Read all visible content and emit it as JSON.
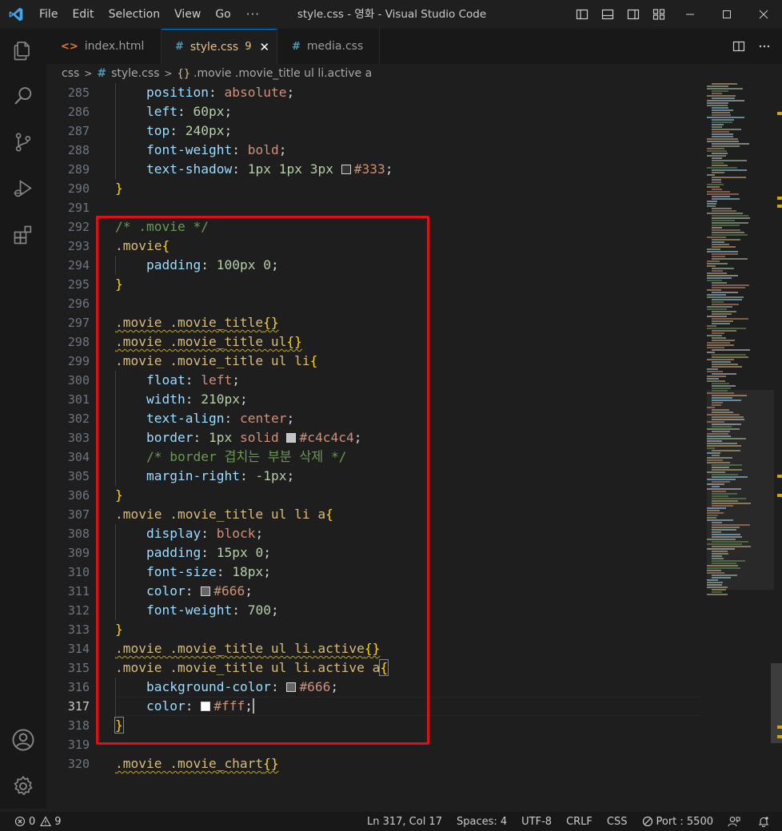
{
  "window": {
    "title": "style.css - 영화 - Visual Studio Code",
    "menu": [
      "File",
      "Edit",
      "Selection",
      "View",
      "Go"
    ],
    "menu_more": "···"
  },
  "tabs": [
    {
      "label": "index.html",
      "icon": "<>",
      "active": false
    },
    {
      "label": "style.css",
      "icon": "#",
      "active": true,
      "problems": "9"
    },
    {
      "label": "media.css",
      "icon": "#",
      "active": false
    }
  ],
  "breadcrumb": {
    "folder": "css",
    "file": "style.css",
    "symbol": ".movie .movie_title ul li.active a"
  },
  "editor": {
    "current_line": 317,
    "lines": [
      {
        "n": 285,
        "indent": 1,
        "tokens": [
          {
            "t": "position",
            "c": "prop"
          },
          {
            "t": ": ",
            "c": "punc"
          },
          {
            "t": "absolute",
            "c": "val"
          },
          {
            "t": ";",
            "c": "punc"
          }
        ]
      },
      {
        "n": 286,
        "indent": 1,
        "tokens": [
          {
            "t": "left",
            "c": "prop"
          },
          {
            "t": ": ",
            "c": "punc"
          },
          {
            "t": "60px",
            "c": "num"
          },
          {
            "t": ";",
            "c": "punc"
          }
        ]
      },
      {
        "n": 287,
        "indent": 1,
        "tokens": [
          {
            "t": "top",
            "c": "prop"
          },
          {
            "t": ": ",
            "c": "punc"
          },
          {
            "t": "240px",
            "c": "num"
          },
          {
            "t": ";",
            "c": "punc"
          }
        ]
      },
      {
        "n": 288,
        "indent": 1,
        "tokens": [
          {
            "t": "font-weight",
            "c": "prop"
          },
          {
            "t": ": ",
            "c": "punc"
          },
          {
            "t": "bold",
            "c": "val"
          },
          {
            "t": ";",
            "c": "punc"
          }
        ]
      },
      {
        "n": 289,
        "indent": 1,
        "tokens": [
          {
            "t": "text-shadow",
            "c": "prop"
          },
          {
            "t": ": ",
            "c": "punc"
          },
          {
            "t": "1px",
            "c": "num"
          },
          {
            "t": " ",
            "c": "punc"
          },
          {
            "t": "1px",
            "c": "num"
          },
          {
            "t": " ",
            "c": "punc"
          },
          {
            "t": "3px",
            "c": "num"
          },
          {
            "t": " ",
            "c": "punc"
          },
          {
            "swatch": "#333333"
          },
          {
            "t": "#333",
            "c": "val"
          },
          {
            "t": ";",
            "c": "punc"
          }
        ]
      },
      {
        "n": 290,
        "indent": 0,
        "tokens": [
          {
            "t": "}",
            "c": "brace"
          }
        ]
      },
      {
        "n": 291,
        "indent": 0,
        "tokens": []
      },
      {
        "n": 292,
        "indent": 0,
        "tokens": [
          {
            "t": "/* .movie */",
            "c": "cmt"
          }
        ]
      },
      {
        "n": 293,
        "indent": 0,
        "tokens": [
          {
            "t": ".movie",
            "c": "sel"
          },
          {
            "t": "{",
            "c": "brace"
          }
        ]
      },
      {
        "n": 294,
        "indent": 1,
        "tokens": [
          {
            "t": "padding",
            "c": "prop"
          },
          {
            "t": ": ",
            "c": "punc"
          },
          {
            "t": "100px",
            "c": "num"
          },
          {
            "t": " ",
            "c": "punc"
          },
          {
            "t": "0",
            "c": "num"
          },
          {
            "t": ";",
            "c": "punc"
          }
        ]
      },
      {
        "n": 295,
        "indent": 0,
        "tokens": [
          {
            "t": "}",
            "c": "brace"
          }
        ]
      },
      {
        "n": 296,
        "indent": 0,
        "tokens": []
      },
      {
        "n": 297,
        "indent": 0,
        "tokens": [
          {
            "t": ".movie .movie_title",
            "c": "sel",
            "sq": true
          },
          {
            "t": "{}",
            "c": "brace",
            "sq": true
          }
        ]
      },
      {
        "n": 298,
        "indent": 0,
        "tokens": [
          {
            "t": ".movie .movie_title ul",
            "c": "sel",
            "sq": true
          },
          {
            "t": "{}",
            "c": "brace",
            "sq": true
          }
        ]
      },
      {
        "n": 299,
        "indent": 0,
        "tokens": [
          {
            "t": ".movie .movie_title ul li",
            "c": "sel"
          },
          {
            "t": "{",
            "c": "brace"
          }
        ]
      },
      {
        "n": 300,
        "indent": 1,
        "tokens": [
          {
            "t": "float",
            "c": "prop"
          },
          {
            "t": ": ",
            "c": "punc"
          },
          {
            "t": "left",
            "c": "val"
          },
          {
            "t": ";",
            "c": "punc"
          }
        ]
      },
      {
        "n": 301,
        "indent": 1,
        "tokens": [
          {
            "t": "width",
            "c": "prop"
          },
          {
            "t": ": ",
            "c": "punc"
          },
          {
            "t": "210px",
            "c": "num"
          },
          {
            "t": ";",
            "c": "punc"
          }
        ]
      },
      {
        "n": 302,
        "indent": 1,
        "tokens": [
          {
            "t": "text-align",
            "c": "prop"
          },
          {
            "t": ": ",
            "c": "punc"
          },
          {
            "t": "center",
            "c": "val"
          },
          {
            "t": ";",
            "c": "punc"
          }
        ]
      },
      {
        "n": 303,
        "indent": 1,
        "tokens": [
          {
            "t": "border",
            "c": "prop"
          },
          {
            "t": ": ",
            "c": "punc"
          },
          {
            "t": "1px",
            "c": "num"
          },
          {
            "t": " ",
            "c": "punc"
          },
          {
            "t": "solid",
            "c": "val"
          },
          {
            "t": " ",
            "c": "punc"
          },
          {
            "swatch": "#c4c4c4"
          },
          {
            "t": "#c4c4c4",
            "c": "val"
          },
          {
            "t": ";",
            "c": "punc"
          }
        ]
      },
      {
        "n": 304,
        "indent": 1,
        "tokens": [
          {
            "t": "/* border 겹치는 부분 삭제 */",
            "c": "cmt"
          }
        ]
      },
      {
        "n": 305,
        "indent": 1,
        "tokens": [
          {
            "t": "margin-right",
            "c": "prop"
          },
          {
            "t": ": ",
            "c": "punc"
          },
          {
            "t": "-1px",
            "c": "num"
          },
          {
            "t": ";",
            "c": "punc"
          }
        ]
      },
      {
        "n": 306,
        "indent": 0,
        "tokens": [
          {
            "t": "}",
            "c": "brace"
          }
        ]
      },
      {
        "n": 307,
        "indent": 0,
        "tokens": [
          {
            "t": ".movie .movie_title ul li a",
            "c": "sel"
          },
          {
            "t": "{",
            "c": "brace"
          }
        ]
      },
      {
        "n": 308,
        "indent": 1,
        "tokens": [
          {
            "t": "display",
            "c": "prop"
          },
          {
            "t": ": ",
            "c": "punc"
          },
          {
            "t": "block",
            "c": "val"
          },
          {
            "t": ";",
            "c": "punc"
          }
        ]
      },
      {
        "n": 309,
        "indent": 1,
        "tokens": [
          {
            "t": "padding",
            "c": "prop"
          },
          {
            "t": ": ",
            "c": "punc"
          },
          {
            "t": "15px",
            "c": "num"
          },
          {
            "t": " ",
            "c": "punc"
          },
          {
            "t": "0",
            "c": "num"
          },
          {
            "t": ";",
            "c": "punc"
          }
        ]
      },
      {
        "n": 310,
        "indent": 1,
        "tokens": [
          {
            "t": "font-size",
            "c": "prop"
          },
          {
            "t": ": ",
            "c": "punc"
          },
          {
            "t": "18px",
            "c": "num"
          },
          {
            "t": ";",
            "c": "punc"
          }
        ]
      },
      {
        "n": 311,
        "indent": 1,
        "tokens": [
          {
            "t": "color",
            "c": "prop"
          },
          {
            "t": ": ",
            "c": "punc"
          },
          {
            "swatch": "#666666"
          },
          {
            "t": "#666",
            "c": "val"
          },
          {
            "t": ";",
            "c": "punc"
          }
        ]
      },
      {
        "n": 312,
        "indent": 1,
        "tokens": [
          {
            "t": "font-weight",
            "c": "prop"
          },
          {
            "t": ": ",
            "c": "punc"
          },
          {
            "t": "700",
            "c": "num"
          },
          {
            "t": ";",
            "c": "punc"
          }
        ]
      },
      {
        "n": 313,
        "indent": 0,
        "tokens": [
          {
            "t": "}",
            "c": "brace"
          }
        ]
      },
      {
        "n": 314,
        "indent": 0,
        "tokens": [
          {
            "t": ".movie .movie_title ul li.active",
            "c": "sel",
            "sq": true
          },
          {
            "t": "{}",
            "c": "brace",
            "sq": true
          }
        ]
      },
      {
        "n": 315,
        "indent": 0,
        "tokens": [
          {
            "t": ".movie .movie_title ul li.active a",
            "c": "sel"
          },
          {
            "t": "{",
            "c": "brace",
            "hl": true
          }
        ]
      },
      {
        "n": 316,
        "indent": 1,
        "tokens": [
          {
            "t": "background-color",
            "c": "prop"
          },
          {
            "t": ": ",
            "c": "punc"
          },
          {
            "swatch": "#666666"
          },
          {
            "t": "#666",
            "c": "val"
          },
          {
            "t": ";",
            "c": "punc"
          }
        ]
      },
      {
        "n": 317,
        "indent": 1,
        "tokens": [
          {
            "t": "color",
            "c": "prop"
          },
          {
            "t": ": ",
            "c": "punc"
          },
          {
            "swatch": "#ffffff"
          },
          {
            "t": "#fff",
            "c": "val"
          },
          {
            "t": ";",
            "c": "punc"
          },
          {
            "caret": true
          }
        ]
      },
      {
        "n": 318,
        "indent": 0,
        "tokens": [
          {
            "t": "}",
            "c": "brace",
            "hl": true
          }
        ]
      },
      {
        "n": 319,
        "indent": 0,
        "tokens": []
      },
      {
        "n": 320,
        "indent": 0,
        "tokens": [
          {
            "t": ".movie .movie_chart",
            "c": "sel",
            "sq": true
          },
          {
            "t": "{}",
            "c": "brace",
            "sq": true
          }
        ]
      }
    ]
  },
  "statusbar": {
    "errors": "0",
    "warnings": "9",
    "position": "Ln 317, Col 17",
    "spaces": "Spaces: 4",
    "encoding": "UTF-8",
    "eol": "CRLF",
    "language": "CSS",
    "port": "Port : 5500"
  },
  "colors": {
    "accent": "#0078d4",
    "highlight_box": "#e0101a",
    "warning": "#cca700"
  }
}
